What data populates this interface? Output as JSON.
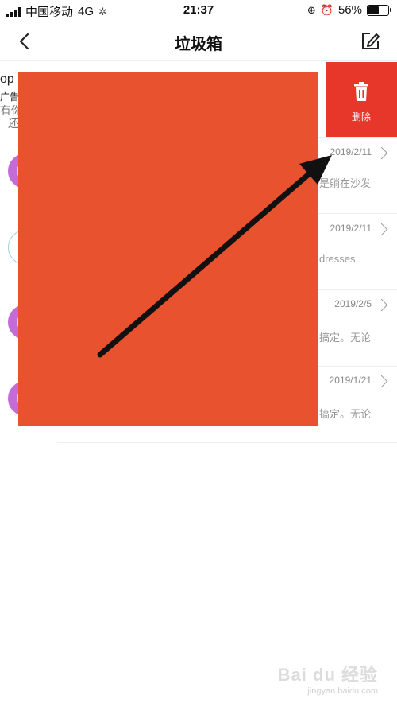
{
  "status_bar": {
    "carrier": "中国移动",
    "network": "4G",
    "time": "21:37",
    "battery_text": "56%",
    "battery_level": 0.56
  },
  "nav": {
    "title": "垃圾箱",
    "back_icon": "chevron-left-icon",
    "edit_icon": "compose-icon"
  },
  "ad_row": {
    "line1": "op S",
    "line2": "广告",
    "line3": "有你",
    "line4": "还"
  },
  "delete_action": {
    "label": "删除",
    "icon": "trash-icon"
  },
  "rows": [
    {
      "date": "2019/2/11",
      "snippet": "是躺在沙发"
    },
    {
      "date": "2019/2/11",
      "snippet": "dresses."
    },
    {
      "date": "2019/2/5",
      "snippet": "搞定。无论"
    },
    {
      "date": "2019/1/21",
      "snippet": "搞定。无论"
    }
  ],
  "watermark": {
    "brand": "Bai du 经验",
    "sub": "jingyan.baidu.com"
  },
  "colors": {
    "delete_red": "#e6372a",
    "redaction_orange": "#e9522e",
    "avatar_purple": "#c56bd8"
  }
}
